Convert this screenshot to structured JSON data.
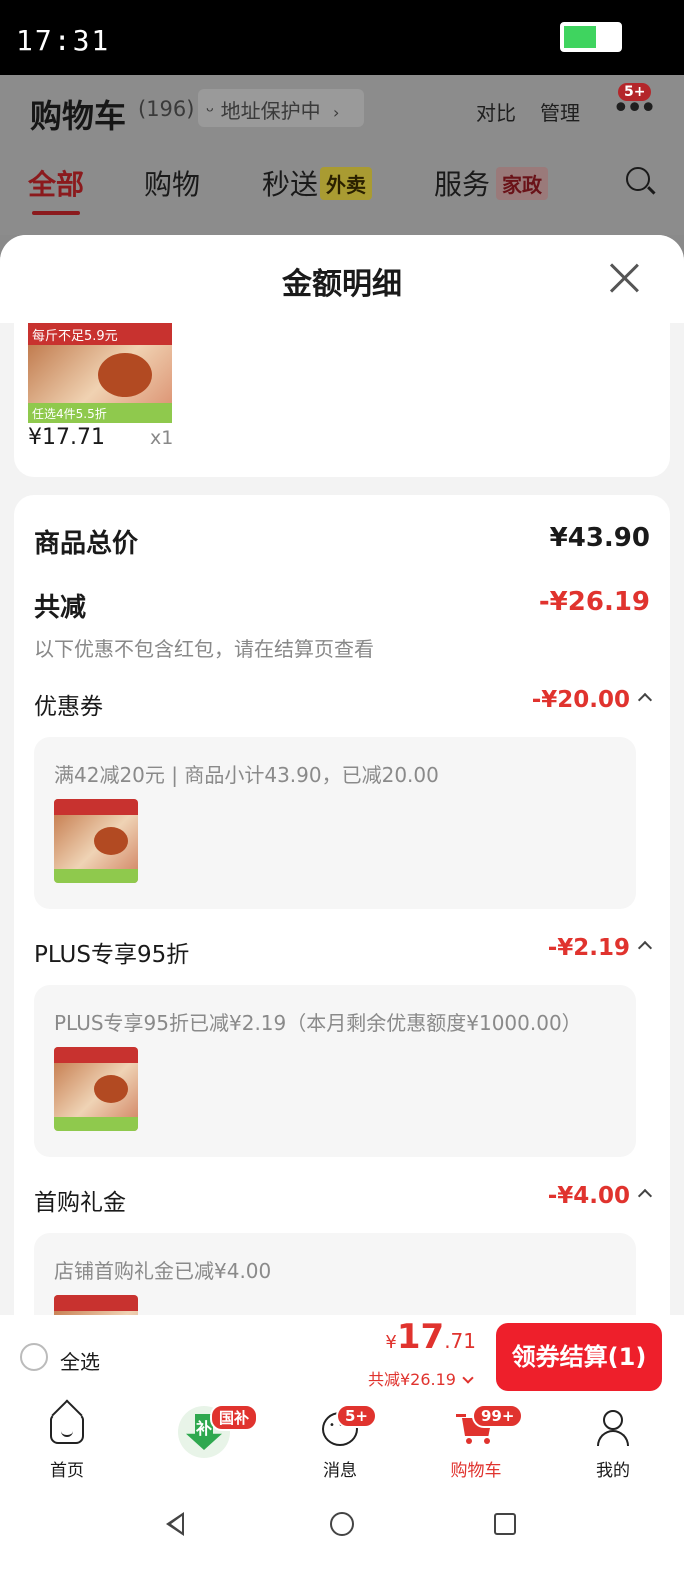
{
  "status_bar": {
    "time": "17:31"
  },
  "cart_header": {
    "title": "购物车",
    "count": "(196)",
    "address_chip": "地址保护中",
    "compare": "对比",
    "manage": "管理",
    "more_badge": "5+"
  },
  "cart_tabs": [
    {
      "label": "全部"
    },
    {
      "label": "购物"
    },
    {
      "label": "秒送",
      "tag": "外卖"
    },
    {
      "label": "服务",
      "tag": "家政"
    }
  ],
  "sheet": {
    "title": "金额明细",
    "product": {
      "thumb_top": "每斤不足5.9元",
      "thumb_bottom": "任选4件5.5折",
      "price": "¥17.71",
      "qty": "x1"
    },
    "total_label": "商品总价",
    "total_value": "¥43.90",
    "reduce_label": "共减",
    "reduce_value": "-¥26.19",
    "note": "以下优惠不包含红包，请在结算页查看",
    "discounts": [
      {
        "label": "优惠券",
        "value": "-¥20.00",
        "detail": "满42减20元 | 商品小计43.90，已减20.00"
      },
      {
        "label": "PLUS专享95折",
        "value": "-¥2.19",
        "detail": "PLUS专享95折已减¥2.19（本月剩余优惠额度¥1000.00）"
      },
      {
        "label": "首购礼金",
        "value": "-¥4.00",
        "detail": "店铺首购礼金已减¥4.00"
      }
    ]
  },
  "checkout": {
    "select_all": "全选",
    "yen": "¥",
    "price_int": "17",
    "price_dec": ".71",
    "reduce_summary": "共减¥26.19",
    "button": "领券结算(1)"
  },
  "bottom_nav": [
    {
      "label": "首页"
    },
    {
      "label": "",
      "badge": "国补",
      "glyph": "补"
    },
    {
      "label": "消息",
      "badge": "5+"
    },
    {
      "label": "购物车",
      "badge": "99+"
    },
    {
      "label": "我的"
    }
  ],
  "colors": {
    "accent": "#E0332E",
    "button": "#EE1F2B",
    "coupon_green": "#8FC94D"
  }
}
